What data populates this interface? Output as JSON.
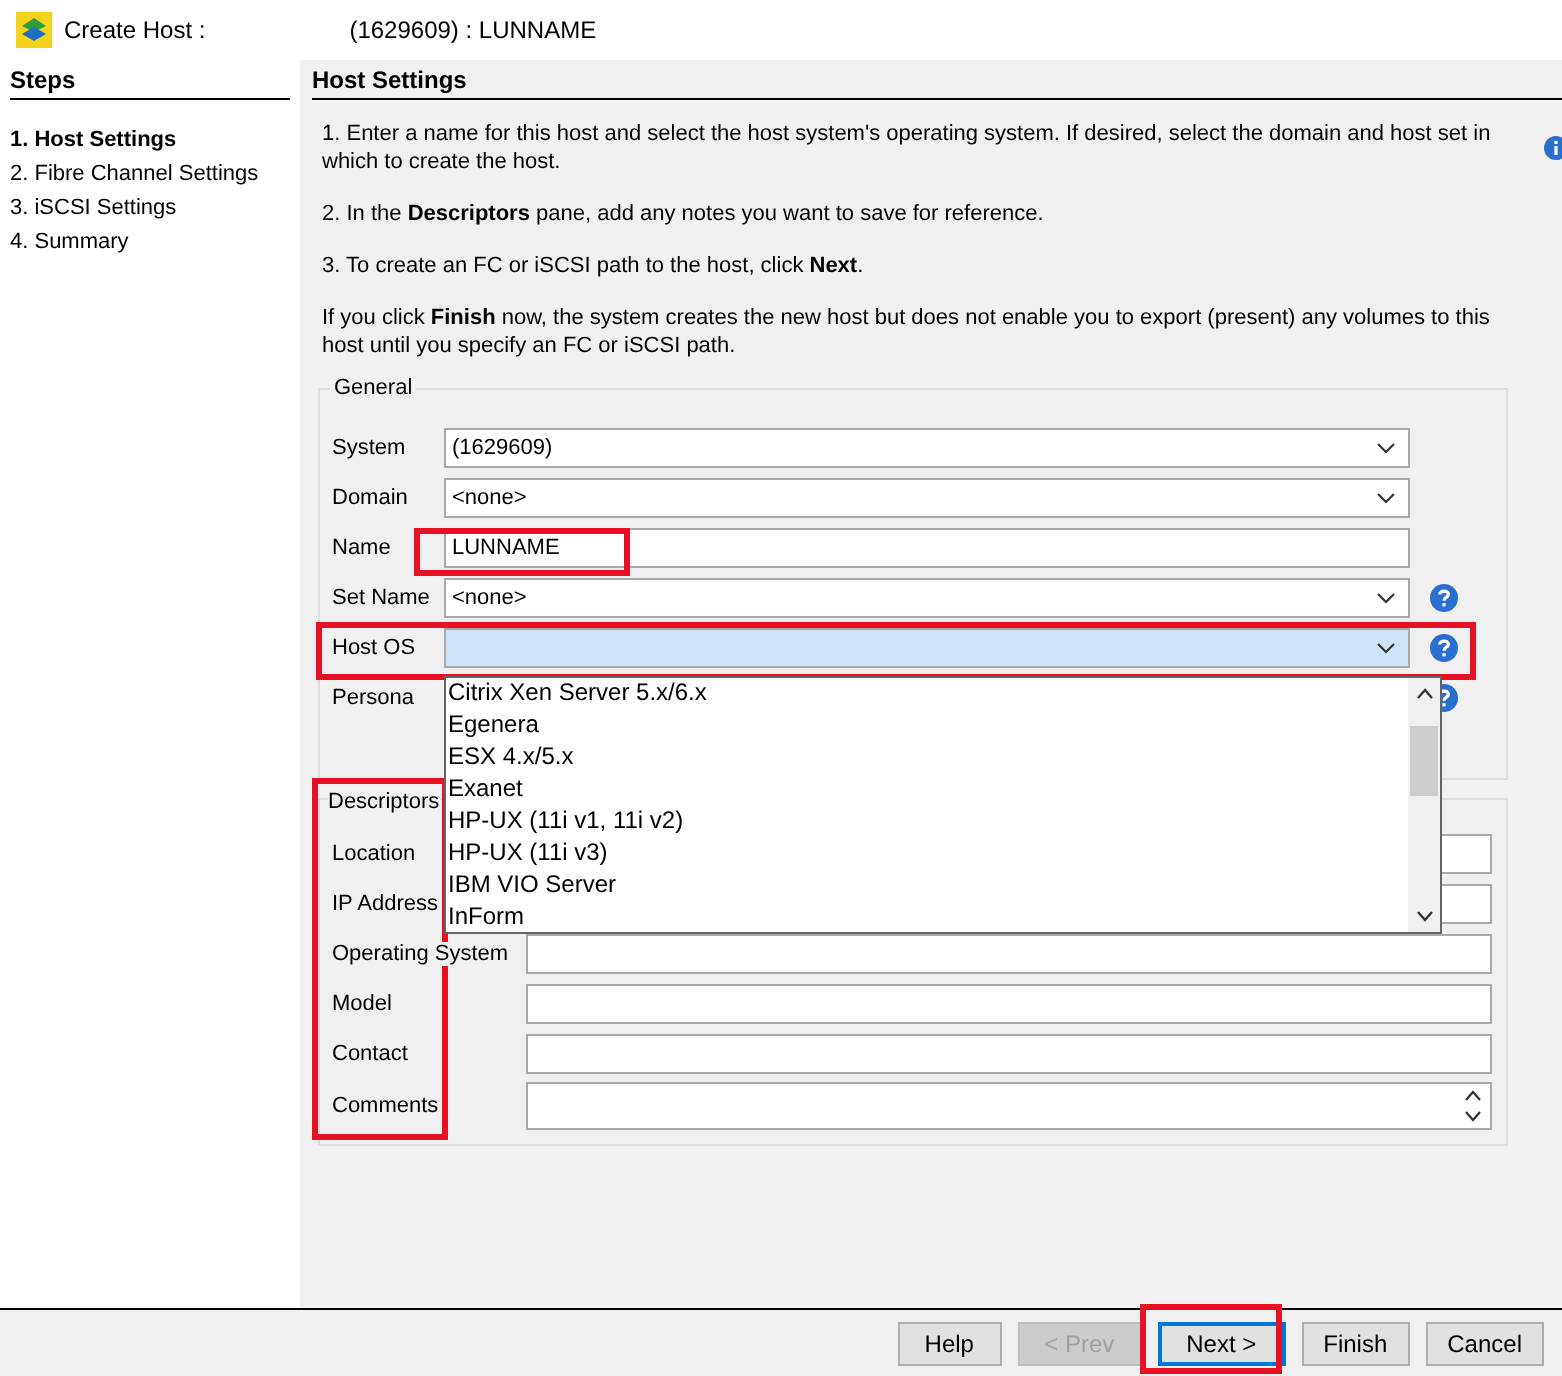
{
  "window": {
    "title_start": "Create Host :",
    "title_end": "(1629609) : LUNNAME"
  },
  "steps": {
    "title": "Steps",
    "items": [
      {
        "label": "1. Host Settings",
        "selected": true
      },
      {
        "label": "2. Fibre Channel Settings",
        "selected": false
      },
      {
        "label": "3. iSCSI Settings",
        "selected": false
      },
      {
        "label": "4. Summary",
        "selected": false
      }
    ]
  },
  "page": {
    "title": "Host Settings",
    "instructions": [
      "1. Enter a name for this host and select the host system's operating system. If desired, select the domain and host set in which to create the host.",
      "2. In the **Descriptors** pane, add any notes you want to save for reference.",
      "3. To create an FC or iSCSI path to the host, click **Next**.",
      "If you click **Finish** now, the system creates the new host but does not enable you to export (present) any volumes to this host until you specify an FC or iSCSI path."
    ]
  },
  "general": {
    "legend": "General",
    "fields": [
      {
        "label": "System",
        "kind": "combo",
        "value": "(1629609)",
        "focused": false,
        "help": false
      },
      {
        "label": "Domain",
        "kind": "combo",
        "value": "<none>",
        "focused": false,
        "help": false
      },
      {
        "label": "Name",
        "kind": "text",
        "value": "LUNNAME",
        "focused": false,
        "help": false
      },
      {
        "label": "Set Name",
        "kind": "combo",
        "value": "<none>",
        "focused": false,
        "help": true
      },
      {
        "label": "Host OS",
        "kind": "combo",
        "focused": true,
        "help": true
      },
      {
        "label": "Persona",
        "help": true
      }
    ]
  },
  "dropdown": {
    "options": [
      "Citrix Xen Server 5.x/6.x",
      "Egenera",
      "ESX 4.x/5.x",
      "Exanet",
      "HP-UX (11i v1, 11i v2)",
      "HP-UX (11i v3)",
      "IBM VIO Server",
      "InForm"
    ]
  },
  "descriptors": {
    "title": "Descriptors",
    "fields": [
      {
        "label": "Location",
        "kind": "text"
      },
      {
        "label": "IP Address",
        "kind": "text"
      },
      {
        "label": "Operating System",
        "kind": "text"
      },
      {
        "label": "Model",
        "kind": "text"
      },
      {
        "label": "Contact",
        "kind": "text"
      },
      {
        "label": "Comments",
        "kind": "multiline"
      }
    ]
  },
  "buttons": [
    {
      "label": "Help",
      "disabled": false,
      "focused": false
    },
    {
      "label": "< Prev",
      "disabled": true,
      "focused": false
    },
    {
      "label": "Next >",
      "disabled": false,
      "focused": true
    },
    {
      "label": "Finish",
      "disabled": false,
      "focused": false
    },
    {
      "label": "Cancel",
      "disabled": false,
      "focused": false
    }
  ]
}
